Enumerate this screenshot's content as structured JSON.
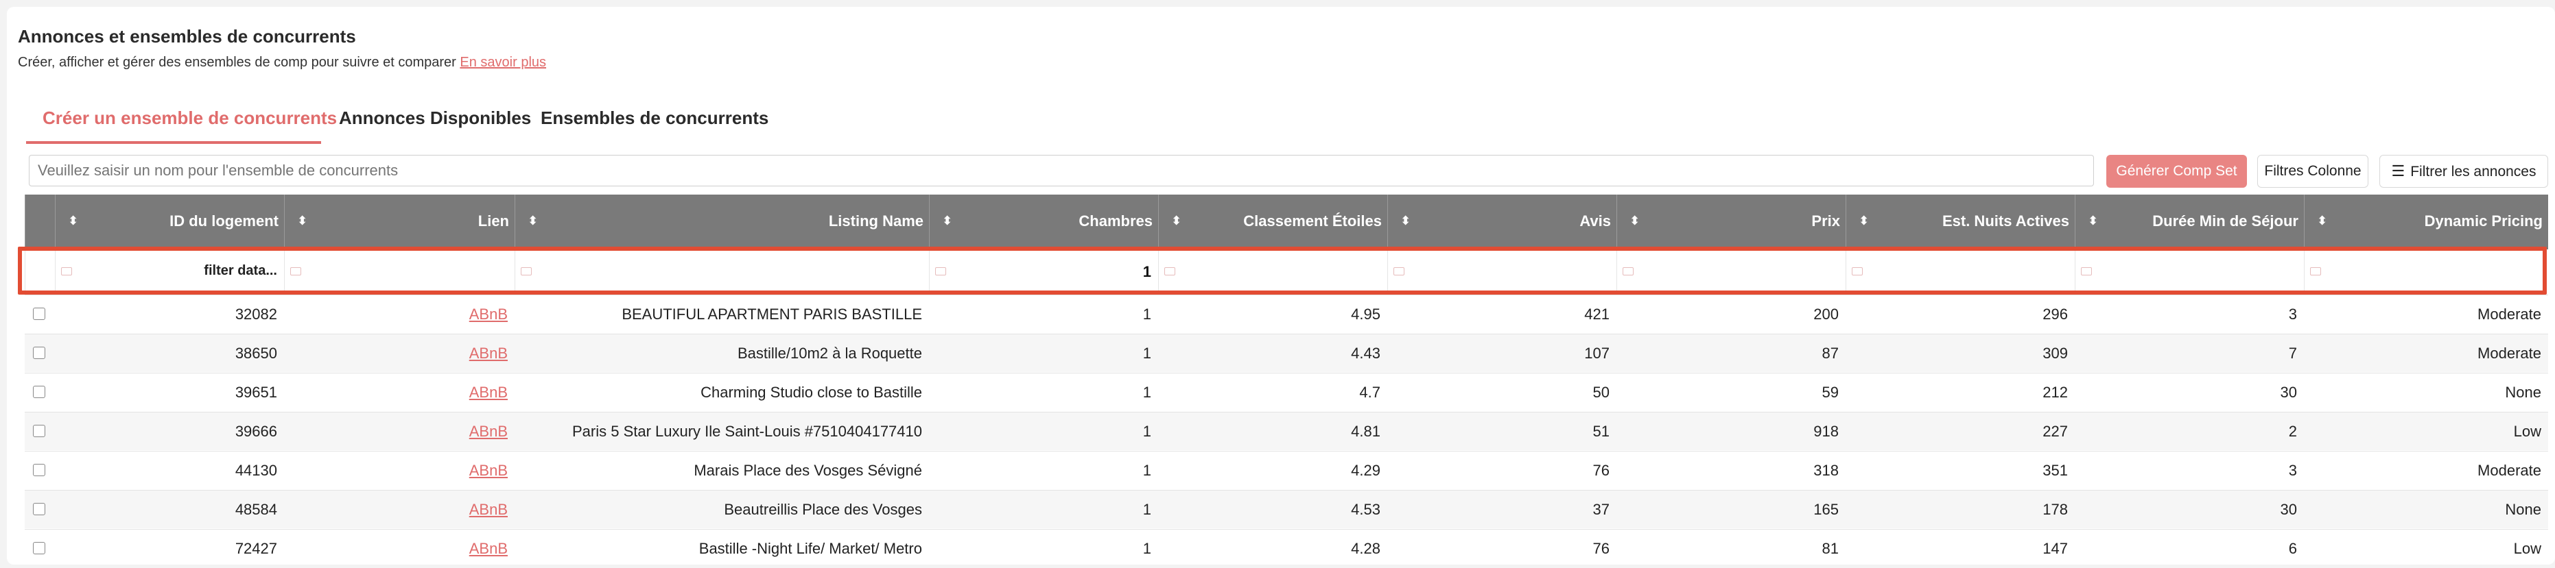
{
  "page": {
    "title": "Annonces et ensembles de concurrents",
    "subtitle": "Créer, afficher et gérer des ensembles de comp pour suivre et comparer",
    "learn_more": "En savoir plus"
  },
  "tabs": [
    {
      "label": "Créer un ensemble de concurrents",
      "active": true
    },
    {
      "label": "Annonces Disponibles",
      "active": false
    },
    {
      "label": "Ensembles de concurrents",
      "active": false
    }
  ],
  "form": {
    "name_placeholder": "Veuillez saisir un nom pour l'ensemble de concurrents",
    "generate_label": "Générer Comp Set",
    "columns_filter_label": "Filtres Colonne",
    "filter_listings_label": "Filtrer les annonces"
  },
  "table": {
    "headers": [
      "ID du logement",
      "Lien",
      "Listing Name",
      "Chambres",
      "Classement Étoiles",
      "Avis",
      "Prix",
      "Est. Nuits Actives",
      "Durée Min de Séjour",
      "Dynamic Pricing"
    ],
    "filters": {
      "id_placeholder": "filter data...",
      "bedrooms_value": "1"
    },
    "rows": [
      [
        "32082",
        "ABnB",
        "BEAUTIFUL APARTMENT PARIS BASTILLE",
        "1",
        "4.95",
        "421",
        "200",
        "296",
        "3",
        "Moderate"
      ],
      [
        "38650",
        "ABnB",
        "Bastille/10m2 à la Roquette",
        "1",
        "4.43",
        "107",
        "87",
        "309",
        "7",
        "Moderate"
      ],
      [
        "39651",
        "ABnB",
        "Charming Studio close to Bastille",
        "1",
        "4.7",
        "50",
        "59",
        "212",
        "30",
        "None"
      ],
      [
        "39666",
        "ABnB",
        "Paris 5 Star Luxury Ile Saint-Louis #7510404177410",
        "1",
        "4.81",
        "51",
        "918",
        "227",
        "2",
        "Low"
      ],
      [
        "44130",
        "ABnB",
        "Marais Place des Vosges Sévigné",
        "1",
        "4.29",
        "76",
        "318",
        "351",
        "3",
        "Moderate"
      ],
      [
        "48584",
        "ABnB",
        "Beautreillis Place des Vosges",
        "1",
        "4.53",
        "37",
        "165",
        "178",
        "30",
        "None"
      ],
      [
        "72427",
        "ABnB",
        "Bastille -Night Life/ Market/ Metro",
        "1",
        "4.28",
        "76",
        "81",
        "147",
        "6",
        "Low"
      ]
    ]
  },
  "colors": {
    "accent": "#e06c6c",
    "header_bg": "#7a7a7a",
    "highlight": "#e24c33"
  }
}
